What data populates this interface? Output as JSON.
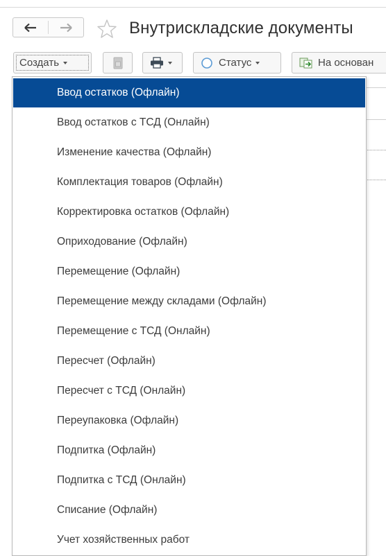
{
  "window": {
    "title": "Внутрискладские документы"
  },
  "toolbar": {
    "create_label": "Создать",
    "status_label": "Статус",
    "based_on_label": "На основан"
  },
  "icons": {
    "back": "arrow-left-icon",
    "forward": "arrow-right-icon",
    "favorite": "star-icon",
    "copy": "copy-icon",
    "print": "printer-icon",
    "status": "circle-icon",
    "based_on": "create-based-on-icon"
  },
  "colors": {
    "selection": "#064b95",
    "selection_text": "#ffffff"
  },
  "menu": {
    "selected_index": 0,
    "items": [
      {
        "label": "Ввод остатков (Офлайн)"
      },
      {
        "label": "Ввод остатков с ТСД (Онлайн)"
      },
      {
        "label": "Изменение качества (Офлайн)"
      },
      {
        "label": "Комплектация товаров (Офлайн)"
      },
      {
        "label": "Корректировка остатков (Офлайн)"
      },
      {
        "label": "Оприходование (Офлайн)"
      },
      {
        "label": "Перемещение (Офлайн)"
      },
      {
        "label": "Перемещение между складами (Офлайн)"
      },
      {
        "label": "Перемещение с ТСД (Онлайн)"
      },
      {
        "label": "Пересчет (Офлайн)"
      },
      {
        "label": "Пересчет с ТСД (Онлайн)"
      },
      {
        "label": "Переупаковка (Офлайн)"
      },
      {
        "label": "Подпитка (Офлайн)"
      },
      {
        "label": "Подпитка с ТСД (Онлайн)"
      },
      {
        "label": "Списание (Офлайн)"
      },
      {
        "label": "Учет хозяйственных работ"
      }
    ]
  }
}
